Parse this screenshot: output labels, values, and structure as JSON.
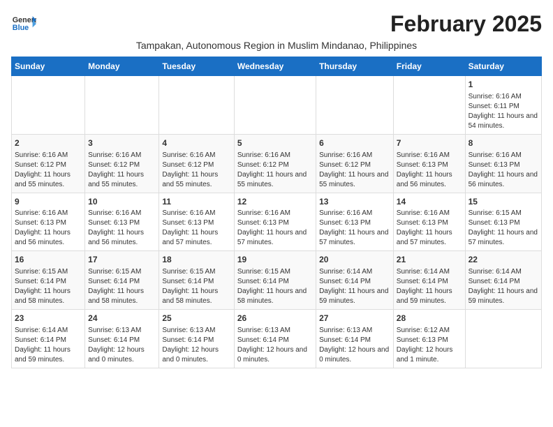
{
  "logo": {
    "general": "General",
    "blue": "Blue"
  },
  "title": "February 2025",
  "subtitle": "Tampakan, Autonomous Region in Muslim Mindanao, Philippines",
  "days_header": [
    "Sunday",
    "Monday",
    "Tuesday",
    "Wednesday",
    "Thursday",
    "Friday",
    "Saturday"
  ],
  "weeks": [
    [
      {
        "day": "",
        "info": ""
      },
      {
        "day": "",
        "info": ""
      },
      {
        "day": "",
        "info": ""
      },
      {
        "day": "",
        "info": ""
      },
      {
        "day": "",
        "info": ""
      },
      {
        "day": "",
        "info": ""
      },
      {
        "day": "1",
        "info": "Sunrise: 6:16 AM\nSunset: 6:11 PM\nDaylight: 11 hours and 54 minutes."
      }
    ],
    [
      {
        "day": "2",
        "info": "Sunrise: 6:16 AM\nSunset: 6:12 PM\nDaylight: 11 hours and 55 minutes."
      },
      {
        "day": "3",
        "info": "Sunrise: 6:16 AM\nSunset: 6:12 PM\nDaylight: 11 hours and 55 minutes."
      },
      {
        "day": "4",
        "info": "Sunrise: 6:16 AM\nSunset: 6:12 PM\nDaylight: 11 hours and 55 minutes."
      },
      {
        "day": "5",
        "info": "Sunrise: 6:16 AM\nSunset: 6:12 PM\nDaylight: 11 hours and 55 minutes."
      },
      {
        "day": "6",
        "info": "Sunrise: 6:16 AM\nSunset: 6:12 PM\nDaylight: 11 hours and 55 minutes."
      },
      {
        "day": "7",
        "info": "Sunrise: 6:16 AM\nSunset: 6:13 PM\nDaylight: 11 hours and 56 minutes."
      },
      {
        "day": "8",
        "info": "Sunrise: 6:16 AM\nSunset: 6:13 PM\nDaylight: 11 hours and 56 minutes."
      }
    ],
    [
      {
        "day": "9",
        "info": "Sunrise: 6:16 AM\nSunset: 6:13 PM\nDaylight: 11 hours and 56 minutes."
      },
      {
        "day": "10",
        "info": "Sunrise: 6:16 AM\nSunset: 6:13 PM\nDaylight: 11 hours and 56 minutes."
      },
      {
        "day": "11",
        "info": "Sunrise: 6:16 AM\nSunset: 6:13 PM\nDaylight: 11 hours and 57 minutes."
      },
      {
        "day": "12",
        "info": "Sunrise: 6:16 AM\nSunset: 6:13 PM\nDaylight: 11 hours and 57 minutes."
      },
      {
        "day": "13",
        "info": "Sunrise: 6:16 AM\nSunset: 6:13 PM\nDaylight: 11 hours and 57 minutes."
      },
      {
        "day": "14",
        "info": "Sunrise: 6:16 AM\nSunset: 6:13 PM\nDaylight: 11 hours and 57 minutes."
      },
      {
        "day": "15",
        "info": "Sunrise: 6:15 AM\nSunset: 6:13 PM\nDaylight: 11 hours and 57 minutes."
      }
    ],
    [
      {
        "day": "16",
        "info": "Sunrise: 6:15 AM\nSunset: 6:14 PM\nDaylight: 11 hours and 58 minutes."
      },
      {
        "day": "17",
        "info": "Sunrise: 6:15 AM\nSunset: 6:14 PM\nDaylight: 11 hours and 58 minutes."
      },
      {
        "day": "18",
        "info": "Sunrise: 6:15 AM\nSunset: 6:14 PM\nDaylight: 11 hours and 58 minutes."
      },
      {
        "day": "19",
        "info": "Sunrise: 6:15 AM\nSunset: 6:14 PM\nDaylight: 11 hours and 58 minutes."
      },
      {
        "day": "20",
        "info": "Sunrise: 6:14 AM\nSunset: 6:14 PM\nDaylight: 11 hours and 59 minutes."
      },
      {
        "day": "21",
        "info": "Sunrise: 6:14 AM\nSunset: 6:14 PM\nDaylight: 11 hours and 59 minutes."
      },
      {
        "day": "22",
        "info": "Sunrise: 6:14 AM\nSunset: 6:14 PM\nDaylight: 11 hours and 59 minutes."
      }
    ],
    [
      {
        "day": "23",
        "info": "Sunrise: 6:14 AM\nSunset: 6:14 PM\nDaylight: 11 hours and 59 minutes."
      },
      {
        "day": "24",
        "info": "Sunrise: 6:13 AM\nSunset: 6:14 PM\nDaylight: 12 hours and 0 minutes."
      },
      {
        "day": "25",
        "info": "Sunrise: 6:13 AM\nSunset: 6:14 PM\nDaylight: 12 hours and 0 minutes."
      },
      {
        "day": "26",
        "info": "Sunrise: 6:13 AM\nSunset: 6:14 PM\nDaylight: 12 hours and 0 minutes."
      },
      {
        "day": "27",
        "info": "Sunrise: 6:13 AM\nSunset: 6:14 PM\nDaylight: 12 hours and 0 minutes."
      },
      {
        "day": "28",
        "info": "Sunrise: 6:12 AM\nSunset: 6:13 PM\nDaylight: 12 hours and 1 minute."
      },
      {
        "day": "",
        "info": ""
      }
    ]
  ]
}
